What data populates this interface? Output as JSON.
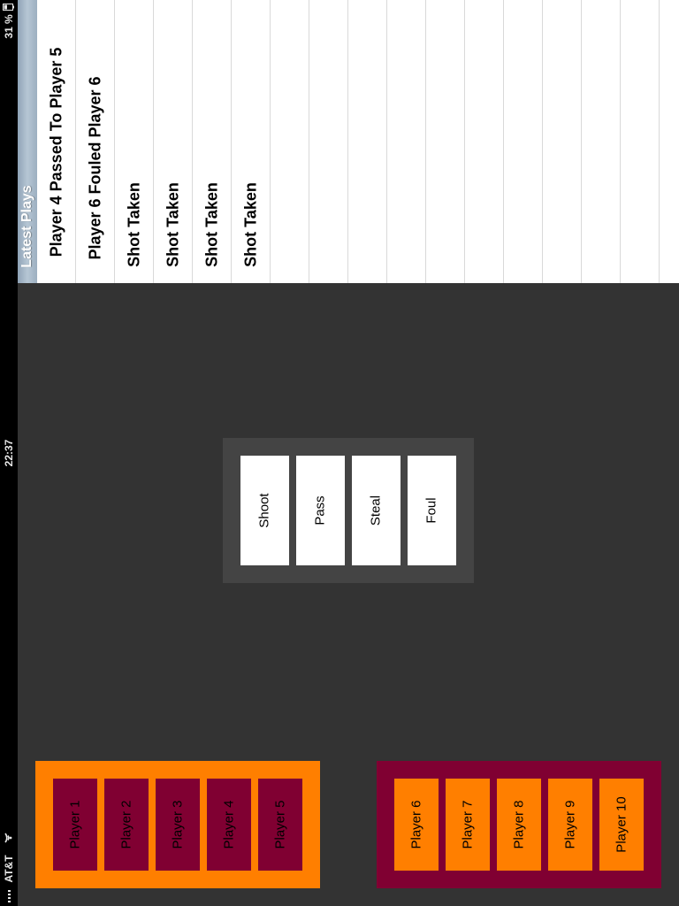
{
  "status_bar": {
    "carrier": "AT&T",
    "time": "22:37",
    "battery": "31 %"
  },
  "latest_plays": {
    "title": "Latest Plays",
    "rows": [
      "Player 4 Passed To Player 5",
      "Player 6 Fouled Player 6",
      "Shot Taken",
      "Shot Taken",
      "Shot Taken",
      "Shot Taken"
    ]
  },
  "actions": [
    "Shoot",
    "Pass",
    "Steal",
    "Foul"
  ],
  "teams": {
    "a": [
      "Player 1",
      "Player 2",
      "Player 3",
      "Player 4",
      "Player 5"
    ],
    "b": [
      "Player 6",
      "Player 7",
      "Player 8",
      "Player 9",
      "Player 10"
    ]
  },
  "colors": {
    "background": "#333333",
    "team_a": "#ff7f00",
    "team_b": "#800032",
    "action_panel": "#444444"
  },
  "icons": [
    "battery-icon",
    "wifi-icon",
    "signal-icon"
  ]
}
